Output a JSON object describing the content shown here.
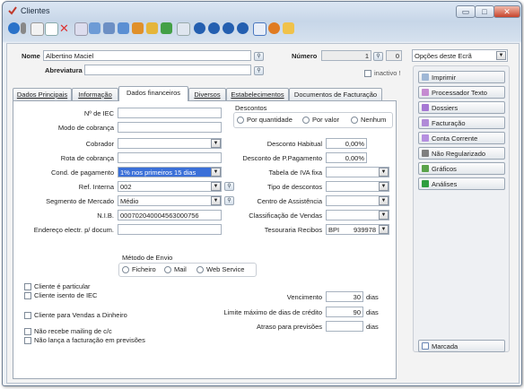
{
  "window": {
    "title": "Clientes",
    "controls": {
      "minimize": "▭",
      "maximize": "□",
      "close": "✕"
    }
  },
  "toolbar": {
    "icons": [
      "back-icon",
      "dropdown-icon",
      "new-icon",
      "copy-icon",
      "delete-icon",
      "properties-icon",
      "grid-icon",
      "folder-icon",
      "print-icon",
      "tools-icon",
      "export-icon",
      "chart-icon",
      "preview-icon",
      "first-icon",
      "previous-icon",
      "next-icon",
      "last-icon",
      "help-icon",
      "refresh-icon",
      "notes-icon"
    ]
  },
  "header": {
    "nome_label": "Nome",
    "nome_value": "Albertino Maciel",
    "abreviatura_label": "Abreviatura",
    "abreviatura_value": "",
    "numero_label": "Número",
    "numero_value": "1",
    "numero_sub_value": "0",
    "inactivo_label": "inactivo !"
  },
  "tabs": [
    {
      "label": "Dados Principais"
    },
    {
      "label": "Informação"
    },
    {
      "label": "Dados financeiros"
    },
    {
      "label": "Diversos"
    },
    {
      "label": "Estabelecimentos"
    },
    {
      "label": "Documentos de Facturação"
    }
  ],
  "financeiros": {
    "iec_label": "Nº de IEC",
    "modo_cobranca_label": "Modo de cobrança",
    "cobrador_label": "Cobrador",
    "rota_cobranca_label": "Rota de cobrança",
    "cond_pagamento_label": "Cond. de pagamento",
    "cond_pagamento_value": "1% nos primeiros 15 dias",
    "ref_interna_label": "Ref. Interna",
    "ref_interna_value": "002",
    "segmento_label": "Segmento de Mercado",
    "segmento_value": "Médio",
    "nib_label": "N.I.B.",
    "nib_value": "000702040004563000756",
    "email_label": "Endereço electr. p/ docum.",
    "descontos_title": "Descontos",
    "desc_por_quantidade": "Por quantidade",
    "desc_por_valor": "Por valor",
    "desc_nenhum": "Nenhum",
    "desconto_habitual_label": "Desconto Habitual",
    "desconto_habitual_value": "0,00%",
    "desconto_pp_label": "Desconto de P.Pagamento",
    "desconto_pp_value": "0,00%",
    "tabela_iva_label": "Tabela de IVA fixa",
    "tipo_descontos_label": "Tipo de descontos",
    "centro_assistencia_label": "Centro de Assistência",
    "classificacao_vendas_label": "Classificação de Vendas",
    "tesouraria_label": "Tesouraria Recibos",
    "tesouraria_bank": "BPI",
    "tesouraria_account": "939978",
    "metodo_envio_title": "Método de Envio",
    "envio_ficheiro": "Ficheiro",
    "envio_mail": "Mail",
    "envio_webservice": "Web Service",
    "cliente_particular": "Cliente é particular",
    "cliente_isento_iec": "Cliente isento de IEC",
    "cliente_vendas_dinheiro": "Cliente para Vendas a Dinheiro",
    "nao_recebe_mailing": "Não recebe mailing de c/c",
    "nao_lanca_facturacao": "Não lança a facturação em previsões",
    "vencimento_label": "Vencimento",
    "vencimento_value": "30",
    "limite_credito_label": "Limite máximo de dias de crédito",
    "limite_credito_value": "90",
    "atraso_label": "Atraso para previsões",
    "atraso_value": "",
    "dias": "dias"
  },
  "sidebar": {
    "opcoes_select": "Opções deste Ecrã",
    "buttons": [
      {
        "label": "Imprimir",
        "icon": "print-icon",
        "color": "#9fb7d6"
      },
      {
        "label": "Processador Texto",
        "icon": "pen-icon",
        "color": "#c58bd1"
      },
      {
        "label": "Dossiers",
        "icon": "folder-icon",
        "color": "#a678d4"
      },
      {
        "label": "Facturação",
        "icon": "invoice-icon",
        "color": "#b08ad7"
      },
      {
        "label": "Conta Corrente",
        "icon": "account-icon",
        "color": "#b58fe0"
      },
      {
        "label": "Não Regularizado",
        "icon": "document-icon",
        "color": "#7f7f7f"
      },
      {
        "label": "Gráficos",
        "icon": "chart-icon",
        "color": "#5aa34a"
      },
      {
        "label": "Análises",
        "icon": "analysis-icon",
        "color": "#2f9e3f"
      }
    ],
    "marcada_label": "Marcada"
  }
}
